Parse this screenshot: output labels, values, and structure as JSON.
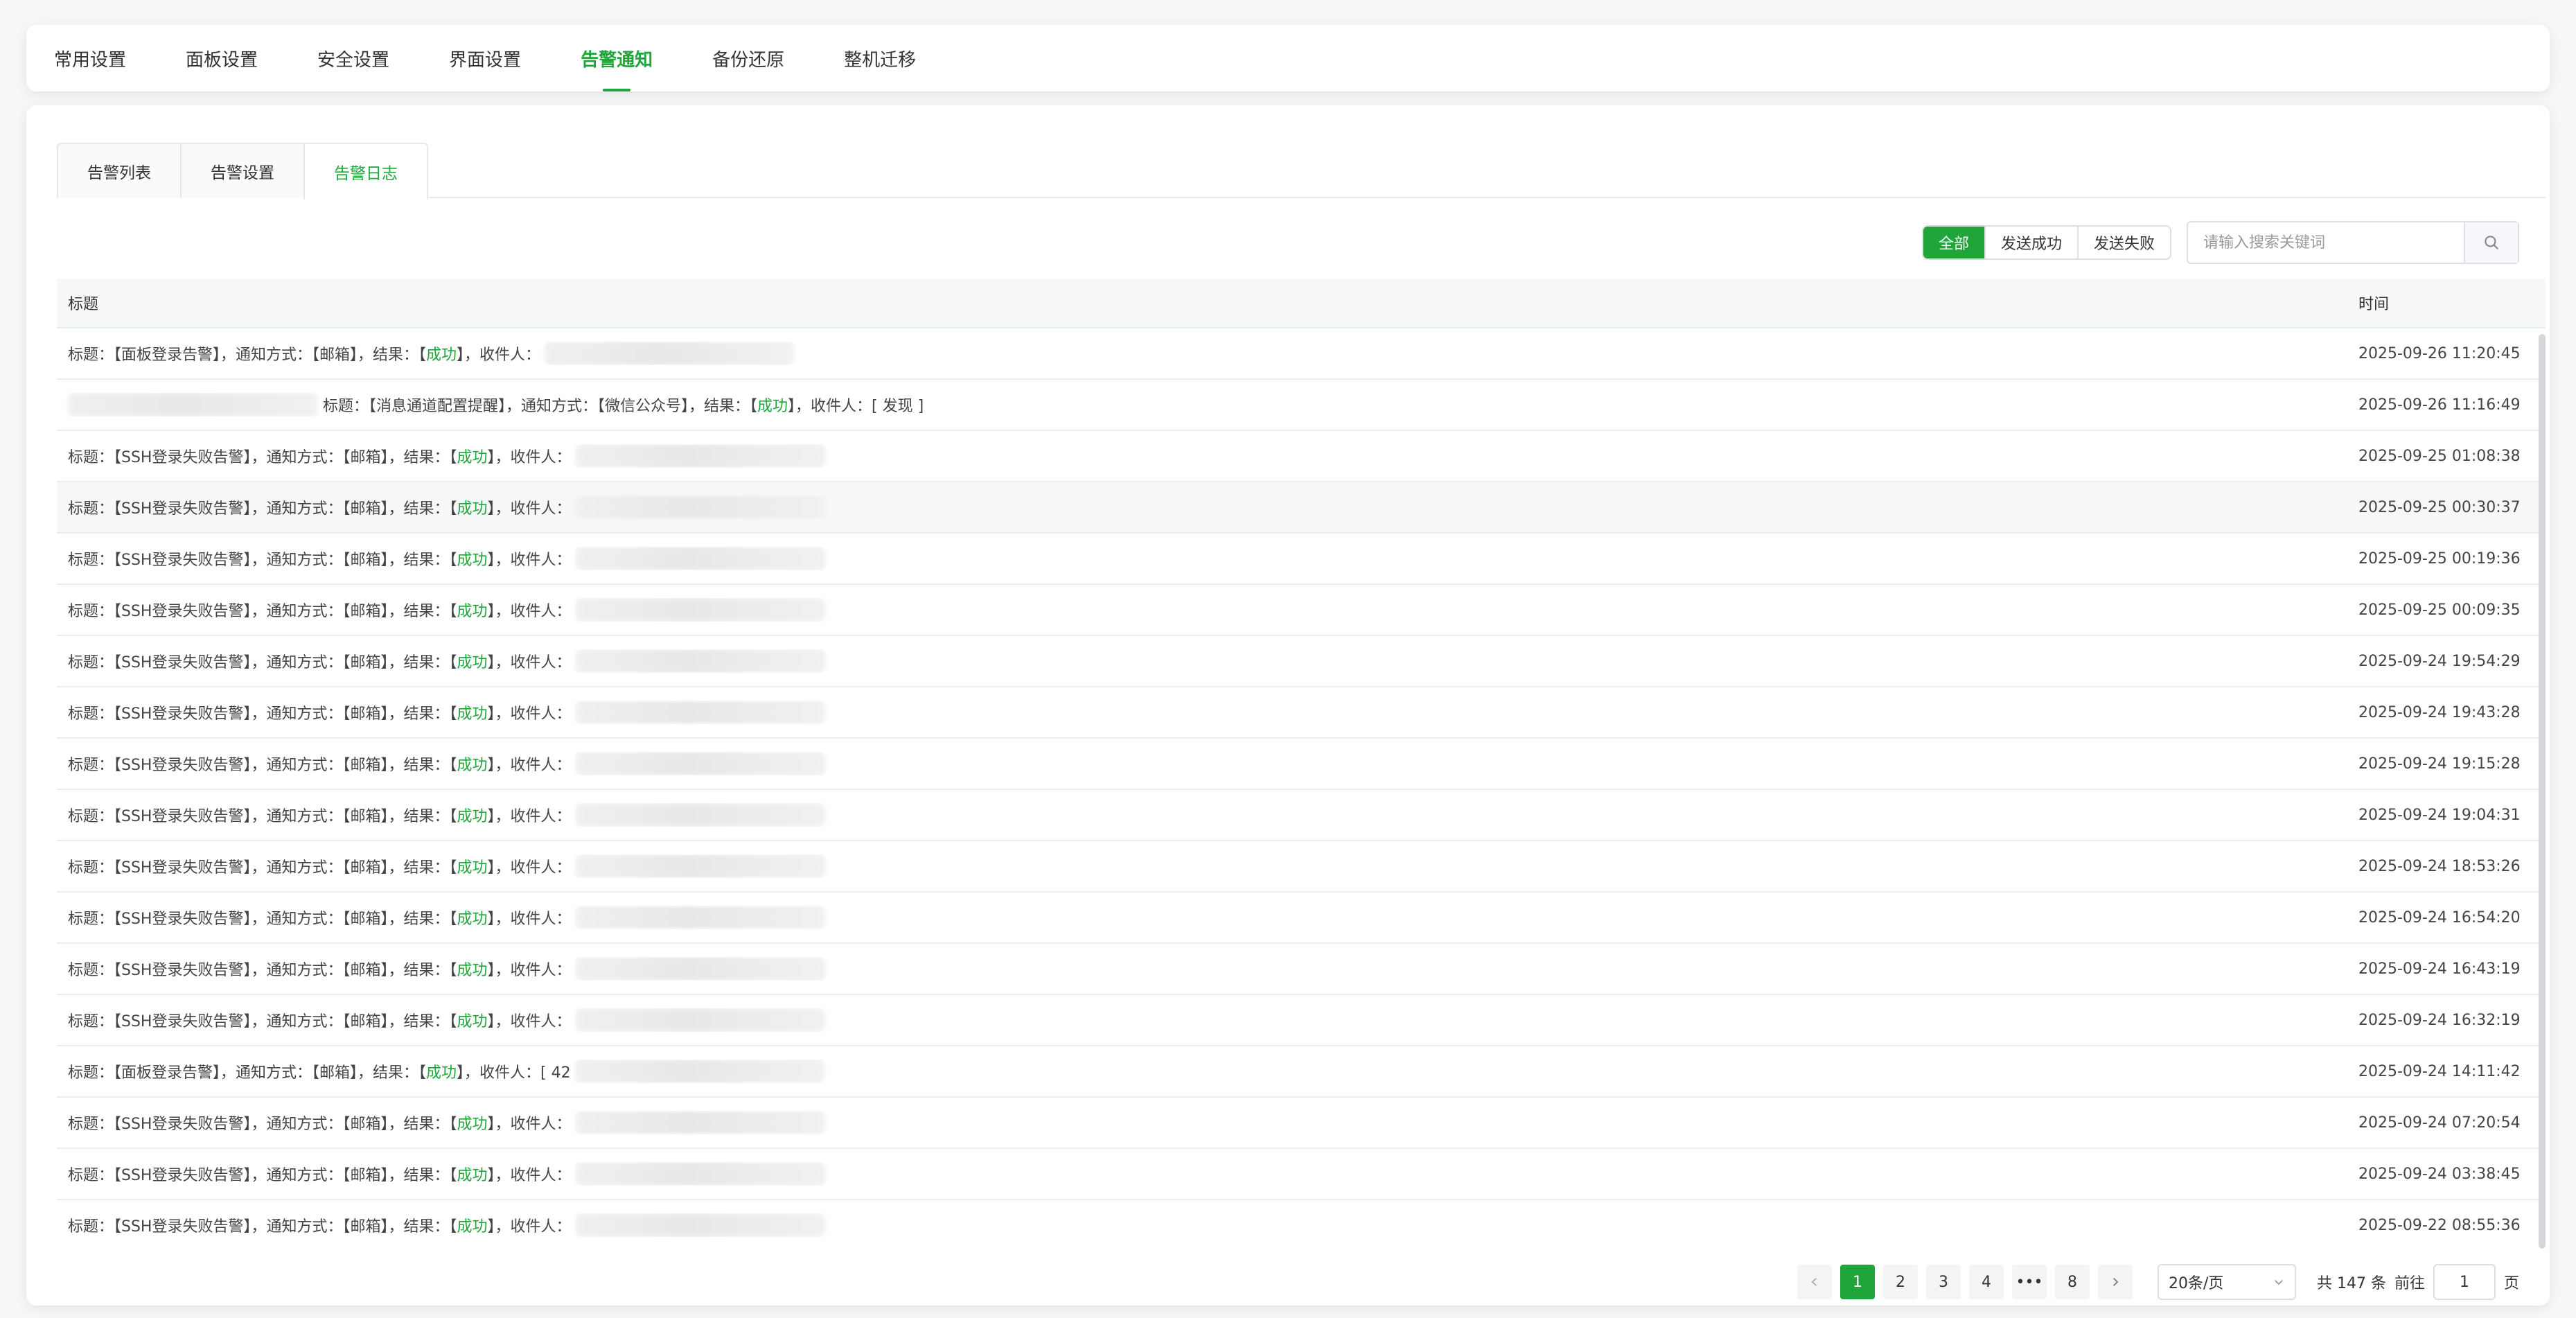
{
  "colors": {
    "accent": "#20a53a",
    "text": "#333333",
    "border": "#e8e8e8"
  },
  "topnav": {
    "items": [
      {
        "label": "常用设置",
        "active": false
      },
      {
        "label": "面板设置",
        "active": false
      },
      {
        "label": "安全设置",
        "active": false
      },
      {
        "label": "界面设置",
        "active": false
      },
      {
        "label": "告警通知",
        "active": true
      },
      {
        "label": "备份还原",
        "active": false
      },
      {
        "label": "整机迁移",
        "active": false
      }
    ]
  },
  "subtabs": {
    "items": [
      {
        "label": "告警列表",
        "active": false
      },
      {
        "label": "告警设置",
        "active": false
      },
      {
        "label": "告警日志",
        "active": true
      }
    ]
  },
  "filter": {
    "options": [
      {
        "label": "全部",
        "active": true
      },
      {
        "label": "发送成功",
        "active": false
      },
      {
        "label": "发送失败",
        "active": false
      }
    ],
    "search_placeholder": "请输入搜索关键词",
    "search_icon": "search-icon"
  },
  "table": {
    "headers": {
      "title": "标题",
      "time": "时间"
    },
    "rows": [
      {
        "prefix": "标题：【面板登录告警】，通知方式：【邮箱】，结果：【",
        "status": "成功",
        "suffix": "】，收件人：",
        "time": "2025-09-26 11:20:45"
      },
      {
        "prefix": "标题：【消息通道配置提醒】，通知方式：【微信公众号】，结果：【",
        "status": "成功",
        "suffix": "】，收件人：[ 发现 ]",
        "time": "2025-09-26 11:16:49",
        "lead_blur": true
      },
      {
        "prefix": "标题：【SSH登录失败告警】，通知方式：【邮箱】，结果：【",
        "status": "成功",
        "suffix": "】，收件人：",
        "time": "2025-09-25 01:08:38"
      },
      {
        "prefix": "标题：【SSH登录失败告警】，通知方式：【邮箱】，结果：【",
        "status": "成功",
        "suffix": "】，收件人：",
        "time": "2025-09-25 00:30:37",
        "hover": true
      },
      {
        "prefix": "标题：【SSH登录失败告警】，通知方式：【邮箱】，结果：【",
        "status": "成功",
        "suffix": "】，收件人：",
        "time": "2025-09-25 00:19:36"
      },
      {
        "prefix": "标题：【SSH登录失败告警】，通知方式：【邮箱】，结果：【",
        "status": "成功",
        "suffix": "】，收件人：",
        "time": "2025-09-25 00:09:35"
      },
      {
        "prefix": "标题：【SSH登录失败告警】，通知方式：【邮箱】，结果：【",
        "status": "成功",
        "suffix": "】，收件人：",
        "time": "2025-09-24 19:54:29"
      },
      {
        "prefix": "标题：【SSH登录失败告警】，通知方式：【邮箱】，结果：【",
        "status": "成功",
        "suffix": "】，收件人：",
        "time": "2025-09-24 19:43:28"
      },
      {
        "prefix": "标题：【SSH登录失败告警】，通知方式：【邮箱】，结果：【",
        "status": "成功",
        "suffix": "】，收件人：",
        "time": "2025-09-24 19:15:28"
      },
      {
        "prefix": "标题：【SSH登录失败告警】，通知方式：【邮箱】，结果：【",
        "status": "成功",
        "suffix": "】，收件人：",
        "time": "2025-09-24 19:04:31"
      },
      {
        "prefix": "标题：【SSH登录失败告警】，通知方式：【邮箱】，结果：【",
        "status": "成功",
        "suffix": "】，收件人：",
        "time": "2025-09-24 18:53:26"
      },
      {
        "prefix": "标题：【SSH登录失败告警】，通知方式：【邮箱】，结果：【",
        "status": "成功",
        "suffix": "】，收件人：",
        "time": "2025-09-24 16:54:20"
      },
      {
        "prefix": "标题：【SSH登录失败告警】，通知方式：【邮箱】，结果：【",
        "status": "成功",
        "suffix": "】，收件人：",
        "time": "2025-09-24 16:43:19"
      },
      {
        "prefix": "标题：【SSH登录失败告警】，通知方式：【邮箱】，结果：【",
        "status": "成功",
        "suffix": "】，收件人：",
        "time": "2025-09-24 16:32:19"
      },
      {
        "prefix": "标题：【面板登录告警】，通知方式：【邮箱】，结果：【",
        "status": "成功",
        "suffix": "】，收件人：[ 42",
        "time": "2025-09-24 14:11:42"
      },
      {
        "prefix": "标题：【SSH登录失败告警】，通知方式：【邮箱】，结果：【",
        "status": "成功",
        "suffix": "】，收件人：",
        "time": "2025-09-24 07:20:54"
      },
      {
        "prefix": "标题：【SSH登录失败告警】，通知方式：【邮箱】，结果：【",
        "status": "成功",
        "suffix": "】，收件人：",
        "time": "2025-09-24 03:38:45"
      },
      {
        "prefix": "标题：【SSH登录失败告警】，通知方式：【邮箱】，结果：【",
        "status": "成功",
        "suffix": "】，收件人：",
        "time": "2025-09-22 08:55:36"
      }
    ]
  },
  "pagination": {
    "prev_icon": "chevron-left-icon",
    "next_icon": "chevron-right-icon",
    "pages": [
      "1",
      "2",
      "3",
      "4",
      "•••",
      "8"
    ],
    "current": "1",
    "page_size": "20条/页",
    "total_text": "共 147 条",
    "goto_label": "前往",
    "goto_value": "1",
    "page_unit": "页"
  }
}
